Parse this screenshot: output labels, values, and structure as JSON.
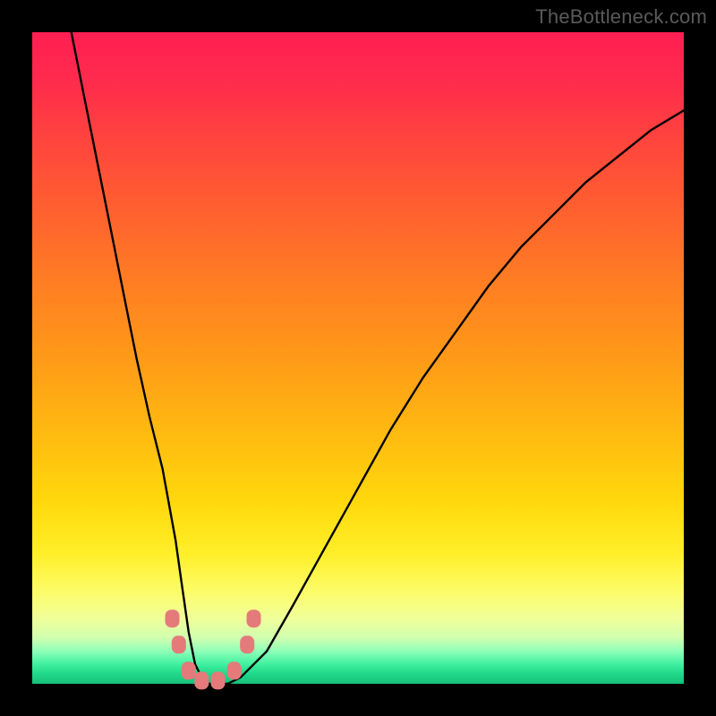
{
  "watermark": "TheBottleneck.com",
  "chart_data": {
    "type": "line",
    "title": "",
    "xlabel": "",
    "ylabel": "",
    "xlim": [
      0,
      100
    ],
    "ylim": [
      0,
      100
    ],
    "series": [
      {
        "name": "curve",
        "x": [
          6,
          8,
          10,
          12,
          14,
          16,
          18,
          20,
          22,
          23,
          24,
          25,
          26,
          27,
          28,
          30,
          32,
          36,
          40,
          45,
          50,
          55,
          60,
          65,
          70,
          75,
          80,
          85,
          90,
          95,
          100
        ],
        "values": [
          100,
          90,
          80,
          70,
          60,
          50,
          41,
          33,
          22,
          15,
          8,
          3,
          1,
          0,
          0,
          0,
          1,
          5,
          12,
          21,
          30,
          39,
          47,
          54,
          61,
          67,
          72,
          77,
          81,
          85,
          88
        ]
      }
    ],
    "markers": [
      {
        "x": 21.5,
        "y": 10
      },
      {
        "x": 22.5,
        "y": 6
      },
      {
        "x": 24.0,
        "y": 2
      },
      {
        "x": 26.0,
        "y": 0.5
      },
      {
        "x": 28.5,
        "y": 0.5
      },
      {
        "x": 31.0,
        "y": 2
      },
      {
        "x": 33.0,
        "y": 6
      },
      {
        "x": 34.0,
        "y": 10
      }
    ],
    "marker_color": "#e47a7a",
    "curve_color": "#000000",
    "gradient_stops": [
      {
        "pos": 0,
        "color": "#ff1f52"
      },
      {
        "pos": 50,
        "color": "#ff9a18"
      },
      {
        "pos": 85,
        "color": "#fcfc6a"
      },
      {
        "pos": 100,
        "color": "#18c07a"
      }
    ]
  }
}
